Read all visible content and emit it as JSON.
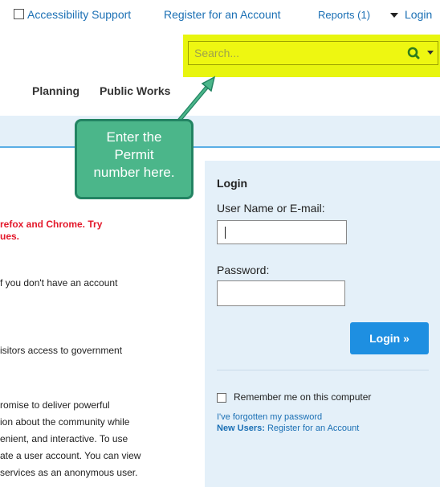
{
  "topbar": {
    "accessibility": "Accessibility Support",
    "register": "Register for an Account",
    "reports": "Reports (1)",
    "login": "Login"
  },
  "search": {
    "placeholder": "Search..."
  },
  "nav": {
    "planning": "Planning",
    "public_works": "Public Works"
  },
  "callout": {
    "line1": "Enter the",
    "line2": "Permit",
    "line3": "number here."
  },
  "content": {
    "warning_line1": "refox and Chrome.  Try",
    "warning_line2": "ues.",
    "line_account": "f you don't have an account",
    "line_visitors": "isitors access to government",
    "para_line1": "romise to deliver powerful",
    "para_line2": "ion about the community while",
    "para_line3": "enient, and interactive. To use",
    "para_line4": "ate a user account. You can view",
    "para_line5": "services as an anonymous user."
  },
  "login_panel": {
    "title": "Login",
    "username_label": "User Name or E-mail:",
    "password_label": "Password:",
    "login_button": "Login »",
    "remember_label": "Remember me on this computer",
    "forgot_link": "I've forgotten my password",
    "new_users_prefix": "New Users:",
    "new_users_link": " Register for an Account"
  },
  "colors": {
    "link": "#1a6fb4",
    "highlight": "#e8f50f",
    "callout": "#4bb68a",
    "button": "#1e8fe1",
    "warning": "#e3182a",
    "panel": "#e4f0f9"
  }
}
